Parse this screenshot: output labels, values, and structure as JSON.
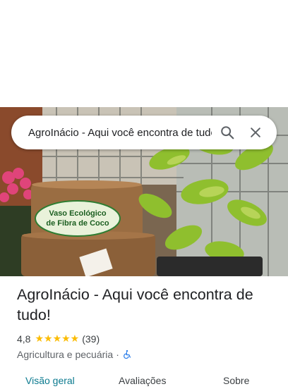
{
  "search": {
    "value": "AgroInácio - Aqui você encontra de tudo!",
    "search_icon": "search-icon",
    "close_icon": "close-icon"
  },
  "hero": {
    "pot_label_line1": "Vaso Ecológico",
    "pot_label_line2": "de Fibra de Coco"
  },
  "place": {
    "title": "AgroInácio - Aqui você encontra de tudo!",
    "rating": "4,8",
    "stars": "★★★★★",
    "review_count": "(39)",
    "category": "Agricultura e pecuária",
    "separator": "·",
    "accessibility_icon": "wheelchair-icon"
  },
  "tabs": [
    {
      "label": "Visão geral",
      "active": true
    },
    {
      "label": "Avaliações",
      "active": false
    },
    {
      "label": "Sobre",
      "active": false
    }
  ],
  "colors": {
    "star": "#fbbc04",
    "active_tab": "#0b7a8f",
    "accessibility": "#1a73e8"
  }
}
